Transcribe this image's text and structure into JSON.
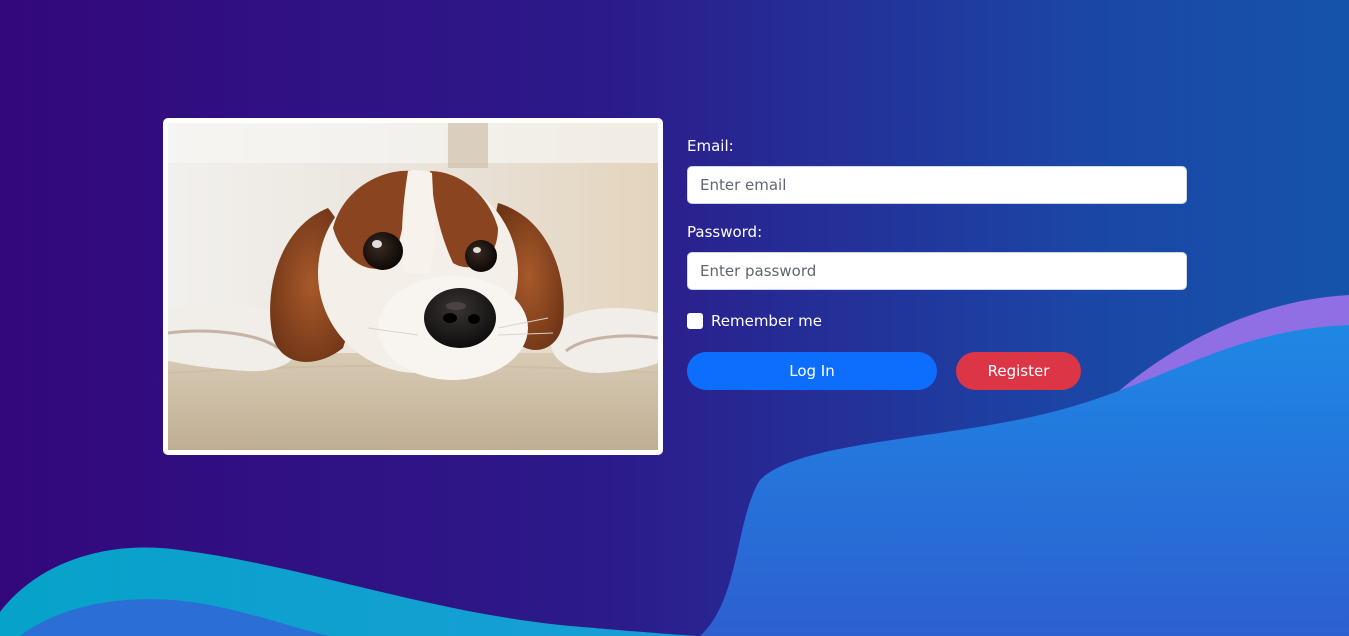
{
  "photo": {
    "subject": "cavalier-spaniel-puppy-lying-on-carpet"
  },
  "login_form": {
    "email": {
      "label": "Email:",
      "placeholder": "Enter email",
      "value": ""
    },
    "password": {
      "label": "Password:",
      "placeholder": "Enter password",
      "value": ""
    },
    "remember": {
      "label": "Remember me",
      "checked": false
    },
    "buttons": {
      "login": "Log In",
      "register": "Register"
    }
  },
  "colors": {
    "background_start": "#33087c",
    "background_end": "#1553aa",
    "login_button": "#0d6efd",
    "register_button": "#dc3545",
    "wave_teal": "#0aa6c8",
    "wave_blue": "#2a6fd8",
    "wave_purple": "#8b6fe0"
  }
}
